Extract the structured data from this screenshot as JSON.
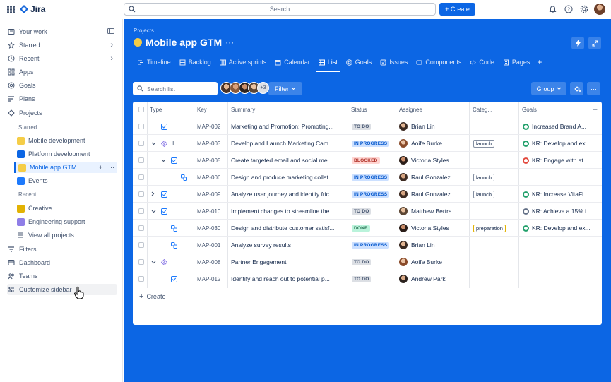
{
  "app": {
    "name": "Jira"
  },
  "topbar": {
    "search_placeholder": "Search",
    "create_label": "+ Create",
    "icons": [
      "notifications-icon",
      "help-icon",
      "settings-icon",
      "avatar"
    ]
  },
  "sidebar": {
    "items": [
      {
        "label": "Your work",
        "icon": "your-work-icon"
      },
      {
        "label": "Starred",
        "icon": "star-icon"
      },
      {
        "label": "Recent",
        "icon": "clock-icon"
      },
      {
        "label": "Apps",
        "icon": "apps-icon"
      },
      {
        "label": "Goals",
        "icon": "goals-icon"
      },
      {
        "label": "Plans",
        "icon": "plans-icon"
      },
      {
        "label": "Projects",
        "icon": "projects-icon"
      }
    ],
    "starred_heading": "Starred",
    "starred_projects": [
      {
        "label": "Mobile development",
        "color": "#f5cd47"
      },
      {
        "label": "Platform development",
        "color": "#0c66e4"
      },
      {
        "label": "Mobile app GTM",
        "color": "#f5cd47"
      },
      {
        "label": "Events",
        "color": "#1d7afc"
      }
    ],
    "recent_heading": "Recent",
    "recent_projects": [
      {
        "label": "Creative",
        "color": "#e2b203"
      },
      {
        "label": "Engineering support",
        "color": "#8f7ee7"
      }
    ],
    "view_all": "View all projects",
    "bottom_items": [
      {
        "label": "Filters",
        "icon": "filter-icon"
      },
      {
        "label": "Dashboard",
        "icon": "dashboard-icon"
      },
      {
        "label": "Teams",
        "icon": "teams-icon"
      },
      {
        "label": "Customize sidebar",
        "icon": "customize-icon"
      }
    ]
  },
  "project": {
    "breadcrumb": "Projects",
    "title": "Mobile app GTM",
    "more": "···"
  },
  "tabs": [
    {
      "label": "Timeline",
      "icon": "timeline-icon"
    },
    {
      "label": "Backlog",
      "icon": "backlog-icon"
    },
    {
      "label": "Active sprints",
      "icon": "board-icon"
    },
    {
      "label": "Calendar",
      "icon": "calendar-icon"
    },
    {
      "label": "List",
      "icon": "list-icon",
      "active": true
    },
    {
      "label": "Goals",
      "icon": "goals-icon"
    },
    {
      "label": "Issues",
      "icon": "issues-icon"
    },
    {
      "label": "Components",
      "icon": "components-icon"
    },
    {
      "label": "Code",
      "icon": "code-icon"
    },
    {
      "label": "Pages",
      "icon": "pages-icon"
    }
  ],
  "toolbar": {
    "search_placeholder": "Search list",
    "avatars_more": "+3",
    "filter_label": "Filter",
    "group_label": "Group"
  },
  "table": {
    "columns": [
      "Type",
      "Key",
      "Summary",
      "Status",
      "Assignee",
      "Categ...",
      "Goals"
    ],
    "rows": [
      {
        "key": "MAP-002",
        "summary": "Marketing and Promotion: Promoting...",
        "status": "TO DO",
        "status_kind": "todo",
        "assignee": "Brian Lin",
        "category": "",
        "goal": "Increased Brand A...",
        "goal_color": "#22a06b",
        "type": "task",
        "indent": 0,
        "expand": ""
      },
      {
        "key": "MAP-003",
        "summary": "Develop and Launch Marketing Cam...",
        "status": "IN PROGRESS",
        "status_kind": "inprog",
        "assignee": "Aoife Burke",
        "category": "launch",
        "goal": "KR: Develop and ex...",
        "goal_color": "#22a06b",
        "type": "epic",
        "indent": 0,
        "expand": "down"
      },
      {
        "key": "MAP-005",
        "summary": "Create targeted email and social me...",
        "status": "BLOCKED",
        "status_kind": "blocked",
        "assignee": "Victoria Styles",
        "category": "",
        "goal": "KR: Engage with at...",
        "goal_color": "#e2483d",
        "type": "task",
        "indent": 1,
        "expand": "down"
      },
      {
        "key": "MAP-006",
        "summary": "Design and produce marketing collat...",
        "status": "IN PROGRESS",
        "status_kind": "inprog",
        "assignee": "Raul Gonzalez",
        "category": "launch",
        "goal": "",
        "goal_color": "",
        "type": "subtask",
        "indent": 2,
        "expand": ""
      },
      {
        "key": "MAP-009",
        "summary": "Analyze user journey and identify fric...",
        "status": "IN PROGRESS",
        "status_kind": "inprog",
        "assignee": "Raul Gonzalez",
        "category": "launch",
        "goal": "KR: Increase VitaFl...",
        "goal_color": "#22a06b",
        "type": "task",
        "indent": 0,
        "expand": "right"
      },
      {
        "key": "MAP-010",
        "summary": "Implement changes to streamline the...",
        "status": "TO DO",
        "status_kind": "todo",
        "assignee": "Matthew Bertra...",
        "category": "",
        "goal": "KR: Achieve a 15% i...",
        "goal_color": "#626f86",
        "type": "task",
        "indent": 0,
        "expand": "down"
      },
      {
        "key": "MAP-030",
        "summary": "Design and distribute customer satisf...",
        "status": "DONE",
        "status_kind": "done",
        "assignee": "Victoria Styles",
        "category": "preparation",
        "goal": "KR: Develop and ex...",
        "goal_color": "#22a06b",
        "type": "subtask",
        "indent": 1,
        "expand": ""
      },
      {
        "key": "MAP-001",
        "summary": "Analyze survey results",
        "status": "IN PROGRESS",
        "status_kind": "inprog",
        "assignee": "Brian Lin",
        "category": "",
        "goal": "",
        "goal_color": "",
        "type": "subtask",
        "indent": 1,
        "expand": ""
      },
      {
        "key": "MAP-008",
        "summary": "Partner Engagement",
        "status": "TO DO",
        "status_kind": "todo",
        "assignee": "Aoife Burke",
        "category": "",
        "goal": "",
        "goal_color": "",
        "type": "epic",
        "indent": 0,
        "expand": "down"
      },
      {
        "key": "MAP-012",
        "summary": "Identify and reach out to potential p...",
        "status": "TO DO",
        "status_kind": "todo",
        "assignee": "Andrew Park",
        "category": "",
        "goal": "",
        "goal_color": "",
        "type": "task",
        "indent": 1,
        "expand": ""
      }
    ],
    "create_label": "Create"
  },
  "colors": {
    "brand_blue": "#0c66e4",
    "text": "#172b4d",
    "subtle": "#44546f"
  }
}
